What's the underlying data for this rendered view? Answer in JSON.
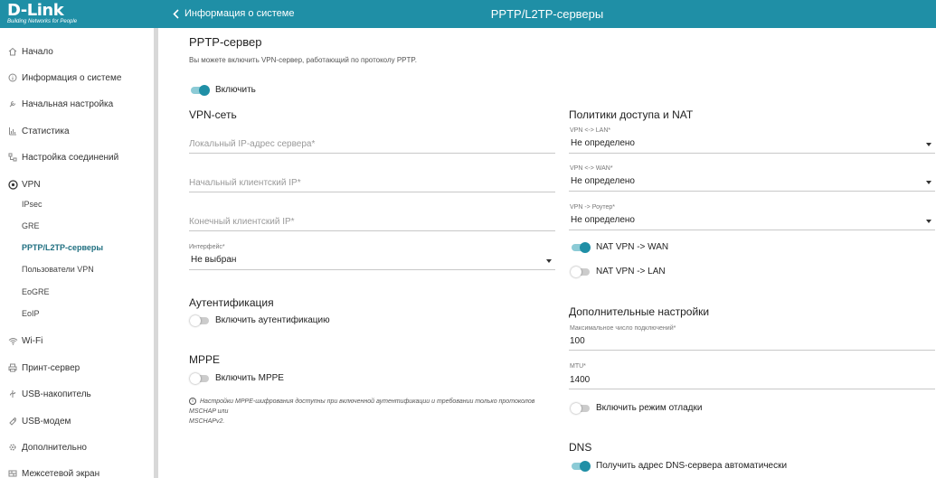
{
  "brand": {
    "name": "D-Link",
    "tagline": "Building Networks for People"
  },
  "header": {
    "back_label": "Информация о системе",
    "title": "PPTP/L2TP-серверы"
  },
  "sidebar": {
    "items": [
      {
        "label": "Начало",
        "icon": "home-icon"
      },
      {
        "label": "Информация о системе",
        "icon": "info-icon"
      },
      {
        "label": "Начальная настройка",
        "icon": "wrench-icon"
      },
      {
        "label": "Статистика",
        "icon": "stats-icon"
      },
      {
        "label": "Настройка соединений",
        "icon": "connections-icon"
      },
      {
        "label": "VPN",
        "icon": "vpn-icon"
      },
      {
        "label": "Wi-Fi",
        "icon": "wifi-icon"
      },
      {
        "label": "Принт-сервер",
        "icon": "printer-icon"
      },
      {
        "label": "USB-накопитель",
        "icon": "usb-icon"
      },
      {
        "label": "USB-модем",
        "icon": "modem-icon"
      },
      {
        "label": "Дополнительно",
        "icon": "gear-icon"
      },
      {
        "label": "Межсетевой экран",
        "icon": "firewall-icon"
      }
    ],
    "vpn_sub": [
      "IPsec",
      "GRE",
      "PPTP/L2TP-серверы",
      "Пользователи VPN",
      "EoGRE",
      "EoIP"
    ]
  },
  "main": {
    "title": "PPTP-сервер",
    "description": "Вы можете включить VPN-сервер, работающий по протоколу PPTP.",
    "enable_label": "Включить",
    "enable_on": true,
    "vpn_net": {
      "title": "VPN-сеть",
      "local_ip_placeholder": "Локальный IP-адрес сервера*",
      "start_ip_placeholder": "Начальный клиентский IP*",
      "end_ip_placeholder": "Конечный клиентский IP*",
      "interface_label": "Интерфейс*",
      "interface_value": "Не выбран"
    },
    "auth": {
      "title": "Аутентификация",
      "toggle_label": "Включить аутентификацию",
      "on": false
    },
    "mppe": {
      "title": "MPPE",
      "toggle_label": "Включить MPPE",
      "on": false,
      "note_line1": "Настройки MPPE-шифрования доступны при включенной аутентификации и требовании только протоколов MSCHAP или",
      "note_line2": "MSCHAPv2."
    },
    "policies": {
      "title": "Политики доступа и NAT",
      "vpn_lan_label": "VPN <-> LAN*",
      "vpn_lan_value": "Не определено",
      "vpn_wan_label": "VPN <-> WAN*",
      "vpn_wan_value": "Не определено",
      "vpn_router_label": "VPN -> Роутер*",
      "vpn_router_value": "Не определено",
      "nat_wan_label": "NAT VPN -> WAN",
      "nat_wan_on": true,
      "nat_lan_label": "NAT VPN -> LAN",
      "nat_lan_on": false
    },
    "advanced": {
      "title": "Дополнительные настройки",
      "max_conn_label": "Максимальное число подключений*",
      "max_conn_value": "100",
      "mtu_label": "MTU*",
      "mtu_value": "1400",
      "debug_label": "Включить режим отладки",
      "debug_on": false
    },
    "dns": {
      "title": "DNS",
      "auto_label": "Получить адрес DNS-сервера автоматически",
      "auto_on": true
    }
  },
  "colors": {
    "accent": "#1f8fa6",
    "toggle_track_on": "#8ccbd6",
    "toggle_off": "#cccccc"
  }
}
